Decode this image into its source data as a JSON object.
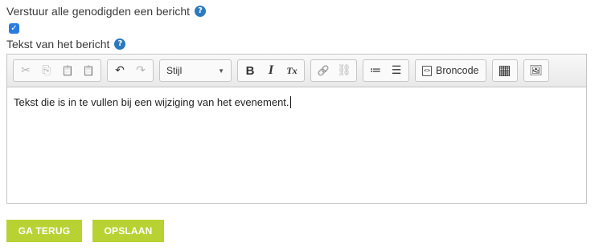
{
  "notify": {
    "label": "Verstuur alle genodigden een bericht",
    "help": "?",
    "checked": true,
    "check_glyph": "✓"
  },
  "message": {
    "label": "Tekst van het bericht",
    "help": "?"
  },
  "toolbar": {
    "cut_icon": "✂",
    "copy_icon": "⎘",
    "paste_icon": "📋",
    "paste_text_icon": "📋",
    "undo_icon": "↶",
    "redo_icon": "↷",
    "style_label": "Stijl",
    "style_arrow": "▼",
    "bold_label": "B",
    "italic_label": "I",
    "remove_format_label": "Tx",
    "link_icon": "🔗",
    "unlink_icon": "⛓",
    "numbered_list_icon": "≔",
    "bulleted_list_icon": "☰",
    "source_icon": "<>",
    "source_label": "Broncode",
    "table_icon": "▦",
    "image_icon": "🖼"
  },
  "editor": {
    "content": "Tekst die is in te vullen bij een wijziging van het evenement."
  },
  "buttons": {
    "back": "GA TERUG",
    "save": "OPSLAAN"
  }
}
